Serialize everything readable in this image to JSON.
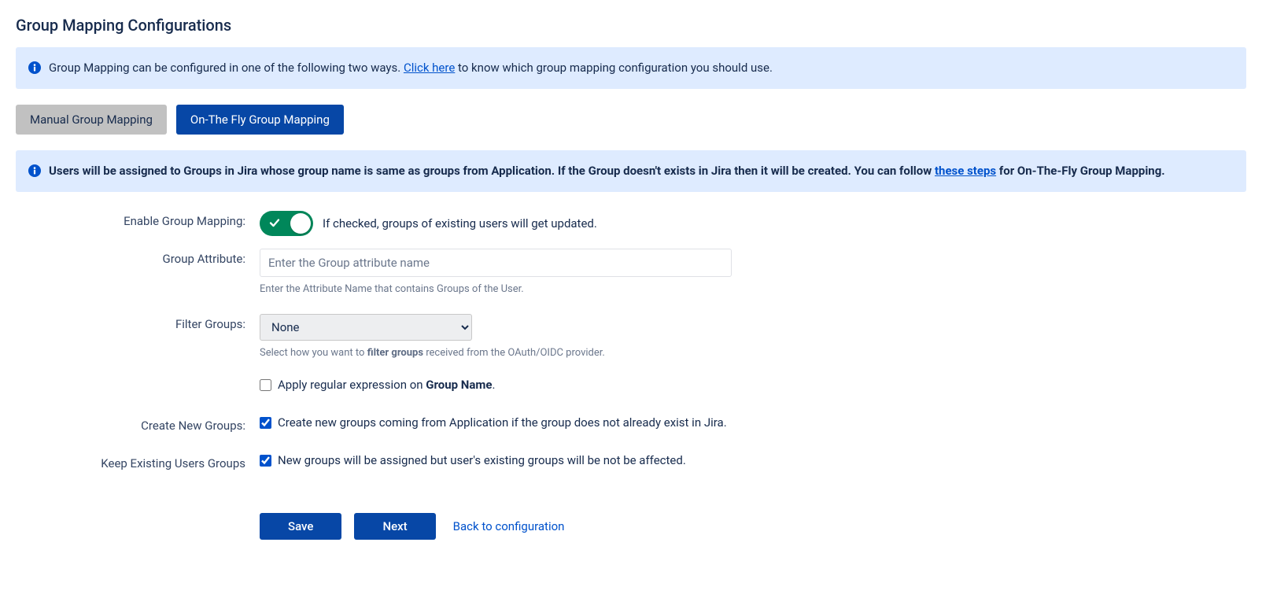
{
  "page_title": "Group Mapping Configurations",
  "banner1": {
    "text_before_link": "Group Mapping can be configured in one of the following two ways. ",
    "link_text": "Click here",
    "text_after_link": " to know which group mapping configuration you should use."
  },
  "tabs": {
    "manual": "Manual Group Mapping",
    "onthefly": "On-The Fly Group Mapping"
  },
  "banner2": {
    "text_before_link": "Users will be assigned to Groups in Jira whose group name is same as groups from Application. If the Group doesn't exists in Jira then it will be created. You can follow ",
    "link_text": "these steps",
    "text_after_link": " for On-The-Fly Group Mapping."
  },
  "form": {
    "enable_group_mapping": {
      "label": "Enable Group Mapping:",
      "checked": true,
      "description": "If checked, groups of existing users will get updated."
    },
    "group_attribute": {
      "label": "Group Attribute:",
      "placeholder": "Enter the Group attribute name",
      "value": "",
      "helper": "Enter the Attribute Name that contains Groups of the User."
    },
    "filter_groups": {
      "label": "Filter Groups:",
      "selected": "None",
      "helper_before": "Select how you want to ",
      "helper_bold": "filter groups",
      "helper_after": " received from the OAuth/OIDC provider."
    },
    "regex": {
      "checked": false,
      "text_before": "Apply regular expression on ",
      "text_bold": "Group Name",
      "text_after": "."
    },
    "create_new_groups": {
      "label": "Create New Groups:",
      "checked": true,
      "description": "Create new groups coming from Application if the group does not already exist in Jira."
    },
    "keep_existing": {
      "label": "Keep Existing Users Groups",
      "checked": true,
      "description": "New groups will be assigned but user's existing groups will be not be affected."
    }
  },
  "buttons": {
    "save": "Save",
    "next": "Next",
    "back": "Back to configuration"
  }
}
